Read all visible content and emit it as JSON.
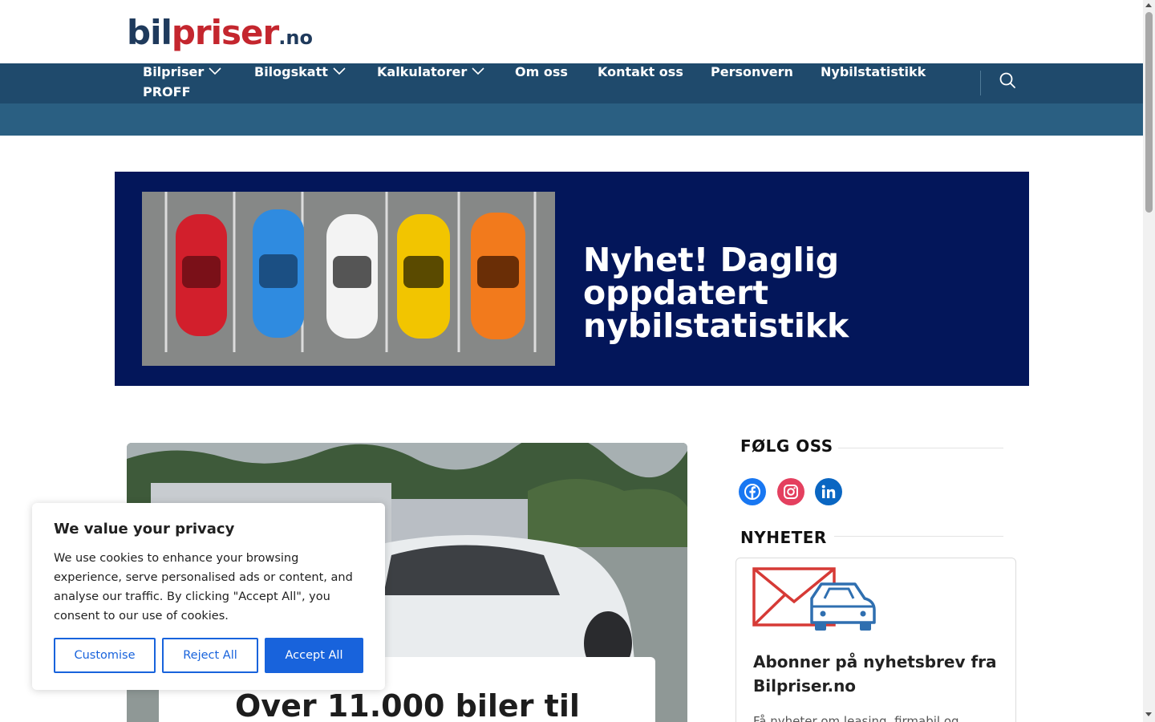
{
  "logo": {
    "part1": "bil",
    "part2": "priser",
    "part3": ".no"
  },
  "nav": {
    "items": [
      {
        "label": "Bilpriser"
      },
      {
        "label": "Bilogskatt"
      },
      {
        "label": "Kalkulatorer"
      },
      {
        "label": "Om oss"
      },
      {
        "label": "Kontakt oss"
      },
      {
        "label": "Personvern"
      },
      {
        "label": "Nybilstatistikk"
      },
      {
        "label": "PROFF"
      }
    ]
  },
  "banner": {
    "title": "Nyhet! Daglig oppdatert nybilstatistikk"
  },
  "article": {
    "title": "Over 11.000 biler til"
  },
  "sidebar": {
    "follow_heading": "FØLG OSS",
    "news_heading": "NYHETER",
    "social": [
      "facebook-icon",
      "instagram-icon",
      "linkedin-icon"
    ],
    "newsletter_title": "Abonner på nyhetsbrev fra Bilpriser.no",
    "newsletter_text": "Få nyheter om leasing, firmabil og"
  },
  "cookie": {
    "title": "We value your privacy",
    "text": "We use cookies to enhance your browsing experience, serve personalised ads or content, and analyse our traffic. By clicking \"Accept All\", you consent to our use of cookies.",
    "customise": "Customise",
    "reject": "Reject All",
    "accept": "Accept All"
  },
  "colors": {
    "nav": "#1f4a6c",
    "subnav": "#2a5f82",
    "banner": "#03165a",
    "accent": "#1863dc",
    "logo_red": "#c4262e",
    "logo_blue": "#1f3a5c"
  }
}
